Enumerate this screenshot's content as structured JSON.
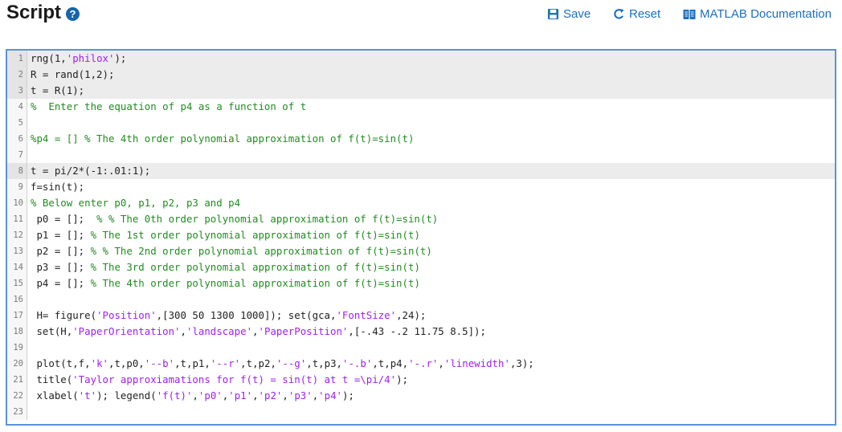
{
  "header": {
    "title": "Script",
    "help_glyph": "?",
    "save_label": "Save",
    "reset_label": "Reset",
    "docs_label": "MATLAB Documentation"
  },
  "colors": {
    "link": "#1e6fbf",
    "editor_border": "#5b93d6",
    "string": "#a020f0",
    "comment": "#228b22"
  },
  "editor": {
    "lines": [
      {
        "num": "1",
        "hl": true,
        "segments": [
          [
            "",
            "rng(1,"
          ],
          [
            "str",
            "'philox'"
          ],
          [
            "",
            ");"
          ]
        ]
      },
      {
        "num": "2",
        "hl": true,
        "segments": [
          [
            "",
            "R = rand(1,2);"
          ]
        ]
      },
      {
        "num": "3",
        "hl": true,
        "segments": [
          [
            "",
            "t = R(1);"
          ]
        ]
      },
      {
        "num": "4",
        "hl": false,
        "segments": [
          [
            "cmt",
            "%  Enter the equation of p4 as a function of t"
          ]
        ]
      },
      {
        "num": "5",
        "hl": false,
        "segments": []
      },
      {
        "num": "6",
        "hl": false,
        "segments": [
          [
            "cmt",
            "%p4 = [] % The 4th order polynomial approximation of f(t)=sin(t)"
          ]
        ]
      },
      {
        "num": "7",
        "hl": false,
        "segments": []
      },
      {
        "num": "8",
        "hl": true,
        "segments": [
          [
            "",
            "t = pi/2*(-1:.01:1);"
          ]
        ]
      },
      {
        "num": "9",
        "hl": false,
        "segments": [
          [
            "",
            "f=sin(t);"
          ]
        ]
      },
      {
        "num": "10",
        "hl": false,
        "segments": [
          [
            "cmt",
            "% Below enter p0, p1, p2, p3 and p4"
          ]
        ]
      },
      {
        "num": "11",
        "hl": false,
        "segments": [
          [
            "",
            " p0 = [];  "
          ],
          [
            "cmt",
            "% % The 0th order polynomial approximation of f(t)=sin(t)"
          ]
        ]
      },
      {
        "num": "12",
        "hl": false,
        "segments": [
          [
            "",
            " p1 = []; "
          ],
          [
            "cmt",
            "% The 1st order polynomial approximation of f(t)=sin(t)"
          ]
        ]
      },
      {
        "num": "13",
        "hl": false,
        "segments": [
          [
            "",
            " p2 = []; "
          ],
          [
            "cmt",
            "% % The 2nd order polynomial approximation of f(t)=sin(t)"
          ]
        ]
      },
      {
        "num": "14",
        "hl": false,
        "segments": [
          [
            "",
            " p3 = []; "
          ],
          [
            "cmt",
            "% The 3rd order polynomial approximation of f(t)=sin(t)"
          ]
        ]
      },
      {
        "num": "15",
        "hl": false,
        "segments": [
          [
            "",
            " p4 = []; "
          ],
          [
            "cmt",
            "% The 4th order polynomial approximation of f(t)=sin(t)"
          ]
        ]
      },
      {
        "num": "16",
        "hl": false,
        "segments": []
      },
      {
        "num": "17",
        "hl": false,
        "segments": [
          [
            "",
            " H= figure("
          ],
          [
            "str",
            "'Position'"
          ],
          [
            "",
            ",[300 50 1300 1000]); set(gca,"
          ],
          [
            "str",
            "'FontSize'"
          ],
          [
            "",
            ",24);"
          ]
        ]
      },
      {
        "num": "18",
        "hl": false,
        "segments": [
          [
            "",
            " set(H,"
          ],
          [
            "str",
            "'PaperOrientation'"
          ],
          [
            "",
            ","
          ],
          [
            "str",
            "'landscape'"
          ],
          [
            "",
            ","
          ],
          [
            "str",
            "'PaperPosition'"
          ],
          [
            "",
            ",[-.43 -.2 11.75 8.5]);"
          ]
        ]
      },
      {
        "num": "19",
        "hl": false,
        "segments": []
      },
      {
        "num": "20",
        "hl": false,
        "segments": [
          [
            "",
            " plot(t,f,"
          ],
          [
            "str",
            "'k'"
          ],
          [
            "",
            ",t,p0,"
          ],
          [
            "str",
            "'--b'"
          ],
          [
            "",
            ",t,p1,"
          ],
          [
            "str",
            "'--r'"
          ],
          [
            "",
            ",t,p2,"
          ],
          [
            "str",
            "'--g'"
          ],
          [
            "",
            ",t,p3,"
          ],
          [
            "str",
            "'-.b'"
          ],
          [
            "",
            ",t,p4,"
          ],
          [
            "str",
            "'-.r'"
          ],
          [
            "",
            ","
          ],
          [
            "str",
            "'linewidth'"
          ],
          [
            "",
            ",3);"
          ]
        ]
      },
      {
        "num": "21",
        "hl": false,
        "segments": [
          [
            "",
            " title("
          ],
          [
            "str",
            "'Taylor approxiamations for f(t) = sin(t) at t =\\pi/4'"
          ],
          [
            "",
            ");"
          ]
        ]
      },
      {
        "num": "22",
        "hl": false,
        "segments": [
          [
            "",
            " xlabel("
          ],
          [
            "str",
            "'t'"
          ],
          [
            "",
            "); legend("
          ],
          [
            "str",
            "'f(t)'"
          ],
          [
            "",
            ","
          ],
          [
            "str",
            "'p0'"
          ],
          [
            "",
            ","
          ],
          [
            "str",
            "'p1'"
          ],
          [
            "",
            ","
          ],
          [
            "str",
            "'p2'"
          ],
          [
            "",
            ","
          ],
          [
            "str",
            "'p3'"
          ],
          [
            "",
            ","
          ],
          [
            "str",
            "'p4'"
          ],
          [
            "",
            ");"
          ]
        ]
      },
      {
        "num": "23",
        "hl": false,
        "segments": []
      }
    ]
  }
}
